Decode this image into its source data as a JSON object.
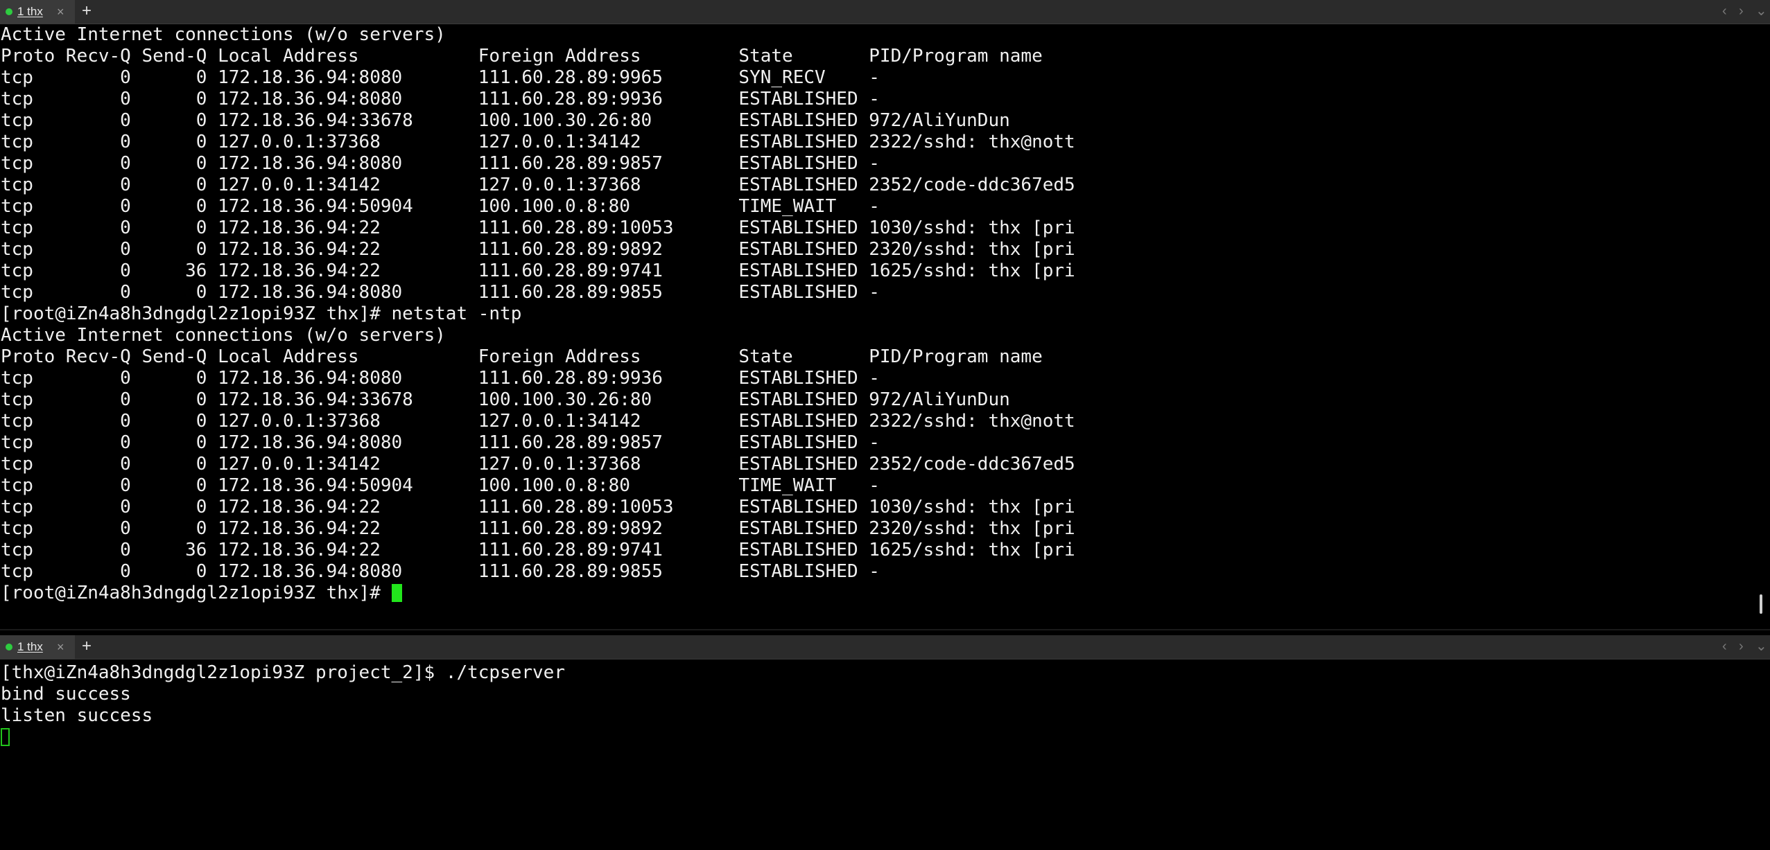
{
  "top_tab": {
    "label": "1 thx",
    "close": "×",
    "add": "+"
  },
  "bottom_tab": {
    "label": "1 thx",
    "close": "×",
    "add": "+"
  },
  "controls": {
    "prev": "‹",
    "next": "›",
    "menu": "⌄"
  },
  "top_terminal": {
    "lines": [
      "Active Internet connections (w/o servers)",
      "Proto Recv-Q Send-Q Local Address           Foreign Address         State       PID/Program name",
      "tcp        0      0 172.18.36.94:8080       111.60.28.89:9965       SYN_RECV    -",
      "tcp        0      0 172.18.36.94:8080       111.60.28.89:9936       ESTABLISHED -",
      "tcp        0      0 172.18.36.94:33678      100.100.30.26:80        ESTABLISHED 972/AliYunDun",
      "tcp        0      0 127.0.0.1:37368         127.0.0.1:34142         ESTABLISHED 2322/sshd: thx@nott",
      "tcp        0      0 172.18.36.94:8080       111.60.28.89:9857       ESTABLISHED -",
      "tcp        0      0 127.0.0.1:34142         127.0.0.1:37368         ESTABLISHED 2352/code-ddc367ed5",
      "tcp        0      0 172.18.36.94:50904      100.100.0.8:80          TIME_WAIT   -",
      "tcp        0      0 172.18.36.94:22         111.60.28.89:10053      ESTABLISHED 1030/sshd: thx [pri",
      "tcp        0      0 172.18.36.94:22         111.60.28.89:9892       ESTABLISHED 2320/sshd: thx [pri",
      "tcp        0     36 172.18.36.94:22         111.60.28.89:9741       ESTABLISHED 1625/sshd: thx [pri",
      "tcp        0      0 172.18.36.94:8080       111.60.28.89:9855       ESTABLISHED -",
      "[root@iZn4a8h3dngdgl2z1opi93Z thx]# netstat -ntp",
      "Active Internet connections (w/o servers)",
      "Proto Recv-Q Send-Q Local Address           Foreign Address         State       PID/Program name",
      "tcp        0      0 172.18.36.94:8080       111.60.28.89:9936       ESTABLISHED -",
      "tcp        0      0 172.18.36.94:33678      100.100.30.26:80        ESTABLISHED 972/AliYunDun",
      "tcp        0      0 127.0.0.1:37368         127.0.0.1:34142         ESTABLISHED 2322/sshd: thx@nott",
      "tcp        0      0 172.18.36.94:8080       111.60.28.89:9857       ESTABLISHED -",
      "tcp        0      0 127.0.0.1:34142         127.0.0.1:37368         ESTABLISHED 2352/code-ddc367ed5",
      "tcp        0      0 172.18.36.94:50904      100.100.0.8:80          TIME_WAIT   -",
      "tcp        0      0 172.18.36.94:22         111.60.28.89:10053      ESTABLISHED 1030/sshd: thx [pri",
      "tcp        0      0 172.18.36.94:22         111.60.28.89:9892       ESTABLISHED 2320/sshd: thx [pri",
      "tcp        0     36 172.18.36.94:22         111.60.28.89:9741       ESTABLISHED 1625/sshd: thx [pri",
      "tcp        0      0 172.18.36.94:8080       111.60.28.89:9855       ESTABLISHED -"
    ],
    "prompt": "[root@iZn4a8h3dngdgl2z1opi93Z thx]# "
  },
  "bottom_terminal": {
    "lines": [
      "[thx@iZn4a8h3dngdgl2z1opi93Z project_2]$ ./tcpserver",
      "bind success",
      "listen success"
    ]
  },
  "colors": {
    "cursor": "#22e61c",
    "tab_dot": "#2ecc40",
    "background": "#000000"
  }
}
